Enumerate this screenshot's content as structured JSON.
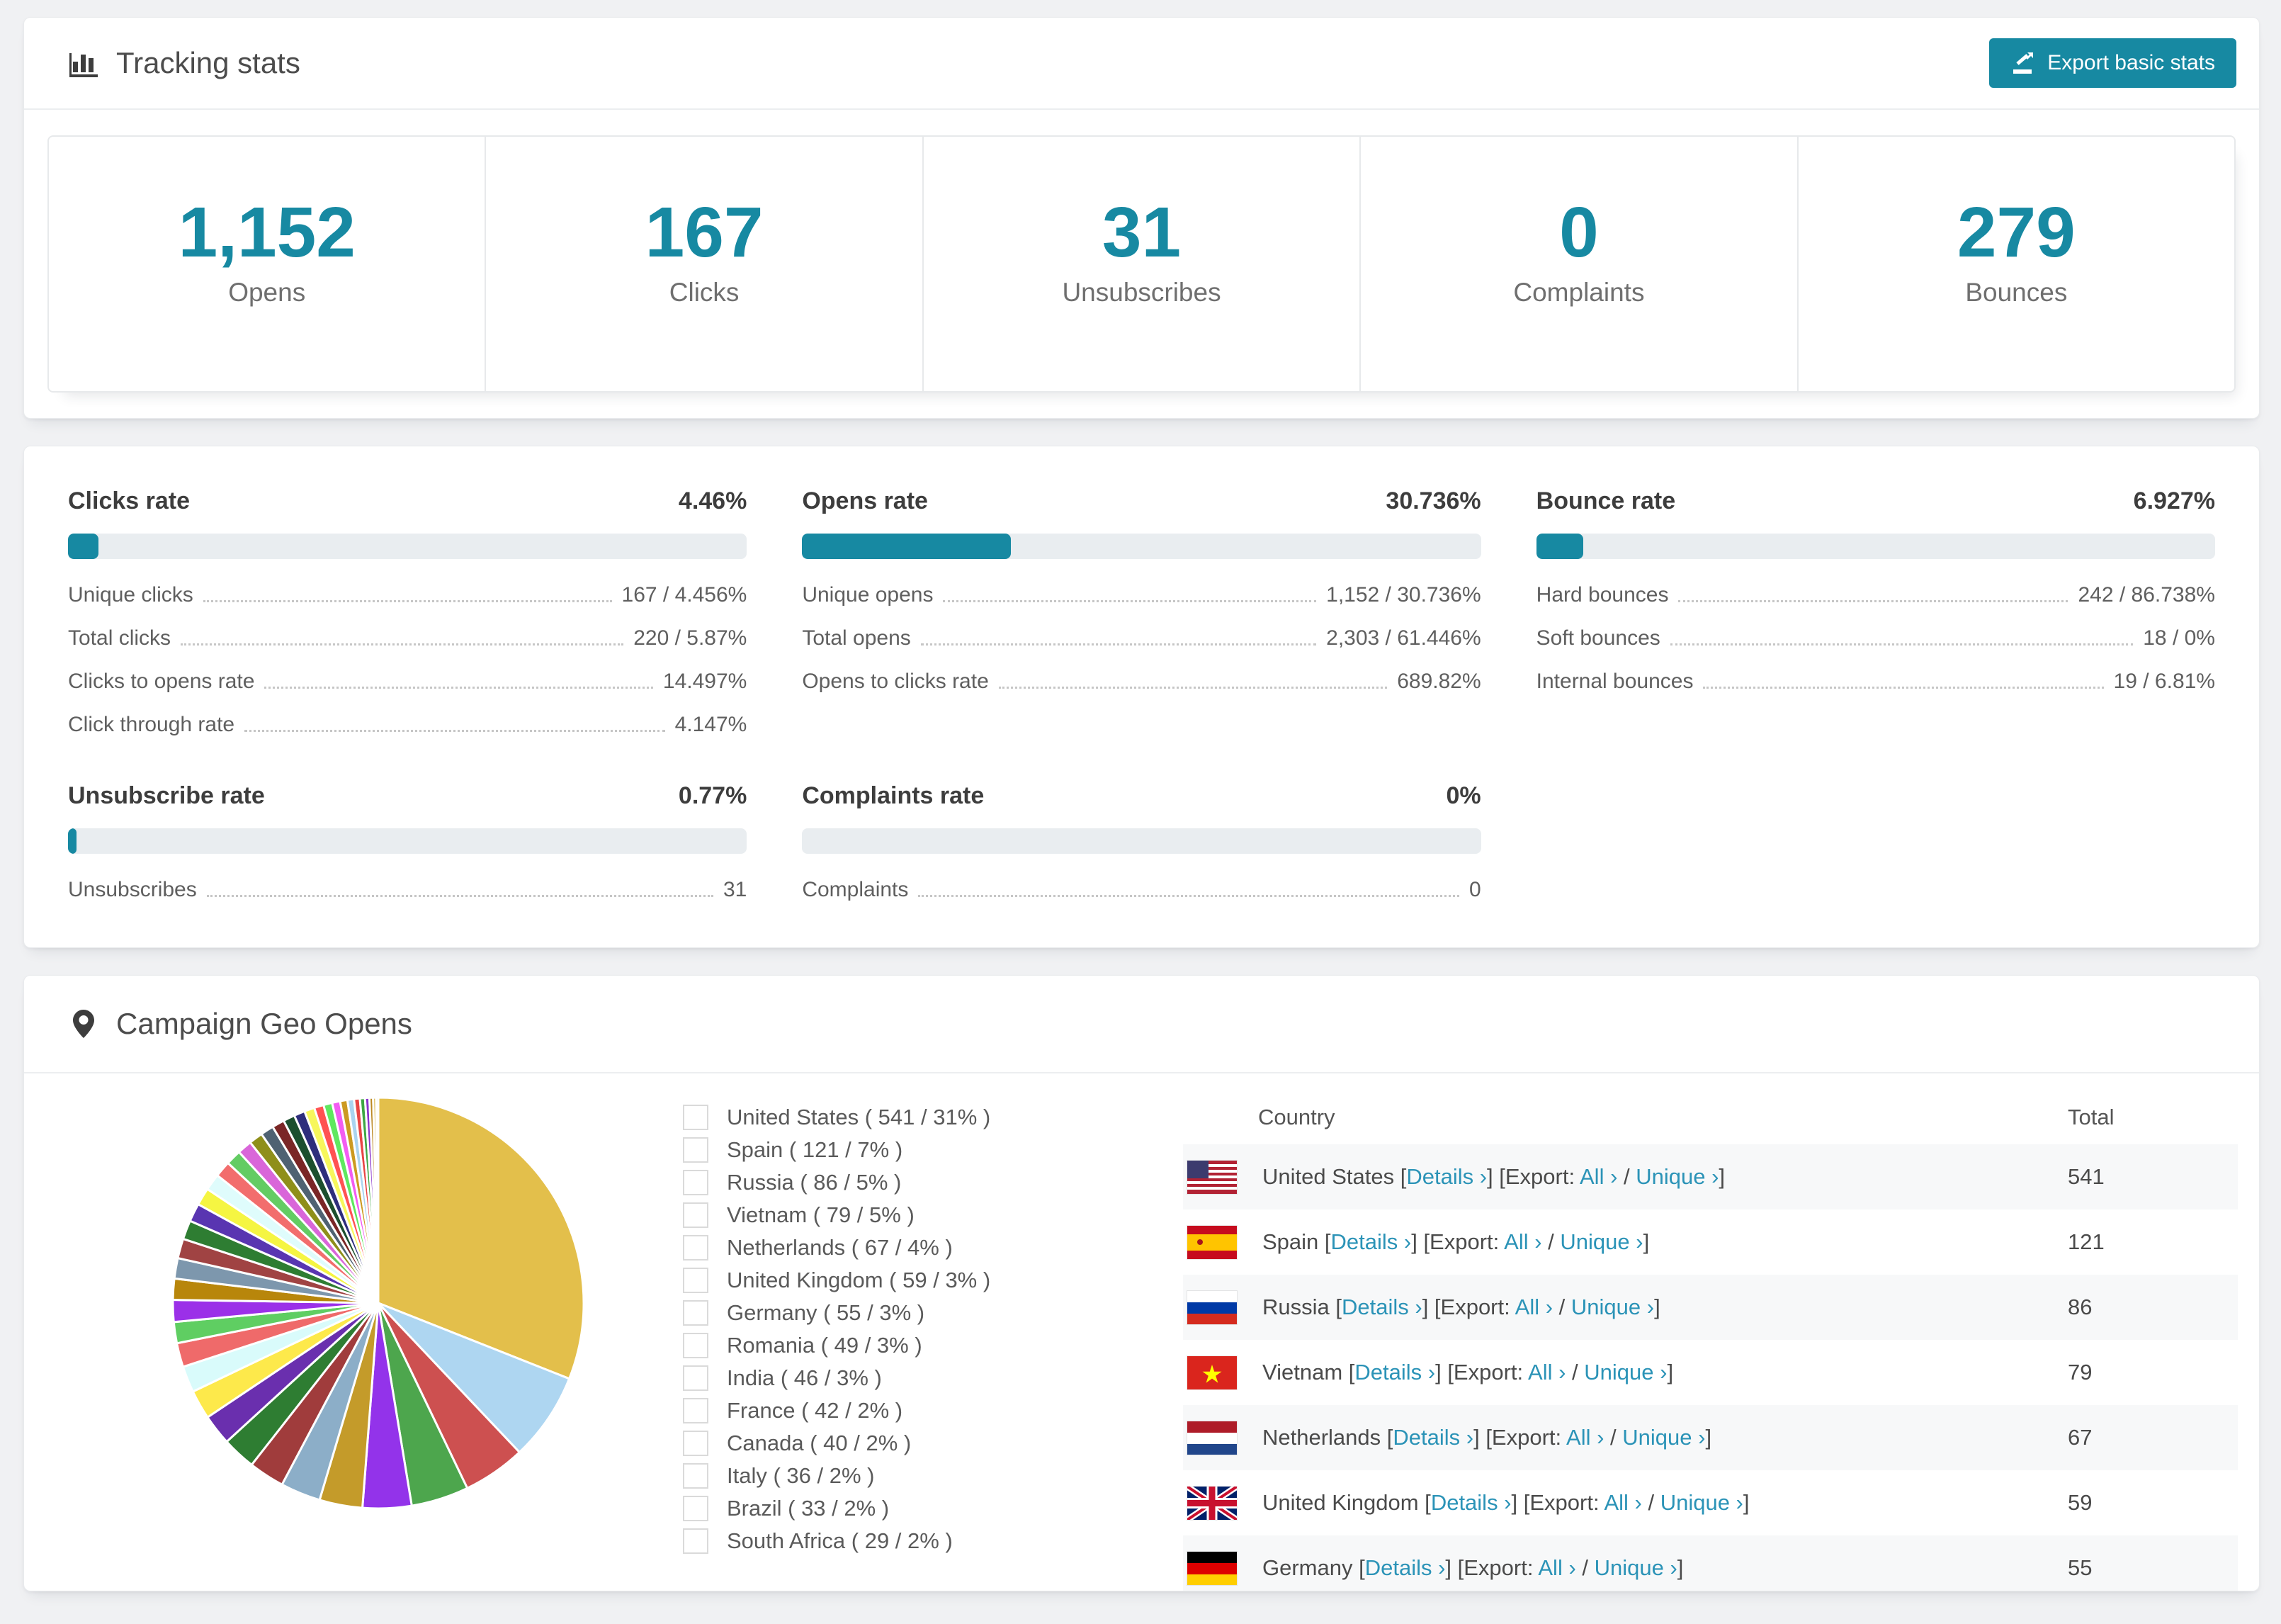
{
  "colors": {
    "teal": "#1789a2",
    "link": "#2b93b7",
    "track": "#e9edf0"
  },
  "header": {
    "title": "Tracking stats",
    "export_label": "Export basic stats"
  },
  "summary": [
    {
      "value": "1,152",
      "label": "Opens"
    },
    {
      "value": "167",
      "label": "Clicks"
    },
    {
      "value": "31",
      "label": "Unsubscribes"
    },
    {
      "value": "0",
      "label": "Complaints"
    },
    {
      "value": "279",
      "label": "Bounces"
    }
  ],
  "rate_panels": [
    {
      "title": "Clicks rate",
      "value": "4.46%",
      "pct": 4.46,
      "rows": [
        [
          "Unique clicks",
          "167 / 4.456%"
        ],
        [
          "Total clicks",
          "220 / 5.87%"
        ],
        [
          "Clicks to opens rate",
          "14.497%"
        ],
        [
          "Click through rate",
          "4.147%"
        ]
      ]
    },
    {
      "title": "Opens rate",
      "value": "30.736%",
      "pct": 30.736,
      "rows": [
        [
          "Unique opens",
          "1,152 / 30.736%"
        ],
        [
          "Total opens",
          "2,303 / 61.446%"
        ],
        [
          "Opens to clicks rate",
          "689.82%"
        ]
      ]
    },
    {
      "title": "Bounce rate",
      "value": "6.927%",
      "pct": 6.927,
      "rows": [
        [
          "Hard bounces",
          "242 / 86.738%"
        ],
        [
          "Soft bounces",
          "18 / 0%"
        ],
        [
          "Internal bounces",
          "19 / 6.81%"
        ]
      ]
    },
    {
      "title": "Unsubscribe rate",
      "value": "0.77%",
      "pct": 0.77,
      "rows": [
        [
          "Unsubscribes",
          "31"
        ]
      ]
    },
    {
      "title": "Complaints rate",
      "value": "0%",
      "pct": 0,
      "rows": [
        [
          "Complaints",
          "0"
        ]
      ]
    }
  ],
  "geo": {
    "title": "Campaign Geo Opens",
    "table": {
      "columns": [
        "Country",
        "Total"
      ],
      "links": {
        "lb": "[",
        "rb": "]",
        "details": "Details ›",
        "export_prefix": "[Export: ",
        "all": "All ›",
        "slash": " / ",
        "unique": "Unique ›"
      },
      "rows": [
        {
          "country": "United States",
          "flag": "us",
          "total": "541"
        },
        {
          "country": "Spain",
          "flag": "es",
          "total": "121"
        },
        {
          "country": "Russia",
          "flag": "ru",
          "total": "86"
        },
        {
          "country": "Vietnam",
          "flag": "vn",
          "total": "79"
        },
        {
          "country": "Netherlands",
          "flag": "nl",
          "total": "67"
        },
        {
          "country": "United Kingdom",
          "flag": "gb",
          "total": "59"
        },
        {
          "country": "Germany",
          "flag": "de",
          "total": "55"
        }
      ]
    }
  },
  "chart_data": {
    "type": "pie",
    "title": "Campaign Geo Opens",
    "legend_position": "right",
    "slices": [
      {
        "label": "United States",
        "value": 541,
        "pct": "31%",
        "color": "#e3bf4b",
        "legend": "United States ( 541 / 31% )"
      },
      {
        "label": "Spain",
        "value": 121,
        "pct": "7%",
        "color": "#aed6f1",
        "legend": "Spain ( 121 / 7% )"
      },
      {
        "label": "Russia",
        "value": 86,
        "pct": "5%",
        "color": "#cd5050",
        "legend": "Russia ( 86 / 5% )"
      },
      {
        "label": "Vietnam",
        "value": 79,
        "pct": "5%",
        "color": "#4da64d",
        "legend": "Vietnam ( 79 / 5% )"
      },
      {
        "label": "Netherlands",
        "value": 67,
        "pct": "4%",
        "color": "#9333ea",
        "legend": "Netherlands ( 67 / 4% )"
      },
      {
        "label": "United Kingdom",
        "value": 59,
        "pct": "3%",
        "color": "#c49b2a",
        "legend": "United Kingdom ( 59 / 3% )"
      },
      {
        "label": "Germany",
        "value": 55,
        "pct": "3%",
        "color": "#8caec8",
        "legend": "Germany ( 55 / 3% )"
      },
      {
        "label": "Romania",
        "value": 49,
        "pct": "3%",
        "color": "#a03c3c",
        "legend": "Romania ( 49 / 3% )"
      },
      {
        "label": "India",
        "value": 46,
        "pct": "3%",
        "color": "#2e7d32",
        "legend": "India ( 46 / 3% )"
      },
      {
        "label": "France",
        "value": 42,
        "pct": "2%",
        "color": "#6a2fae",
        "legend": "France ( 42 / 2% )"
      },
      {
        "label": "Canada",
        "value": 40,
        "pct": "2%",
        "color": "#fde94b",
        "legend": "Canada ( 40 / 2% )"
      },
      {
        "label": "Italy",
        "value": 36,
        "pct": "2%",
        "color": "#d9fbfb",
        "legend": "Italy ( 36 / 2% )"
      },
      {
        "label": "Brazil",
        "value": 33,
        "pct": "2%",
        "color": "#ef6a6a",
        "legend": "Brazil ( 33 / 2% )"
      },
      {
        "label": "South Africa",
        "value": 29,
        "pct": "2%",
        "color": "#5fce62",
        "legend": "South Africa ( 29 / 2% )"
      }
    ],
    "other_slices": [
      {
        "value": 30,
        "color": "#9b30e8"
      },
      {
        "value": 29,
        "color": "#b8860b"
      },
      {
        "value": 28,
        "color": "#7d97ad"
      },
      {
        "value": 27,
        "color": "#a04343"
      },
      {
        "value": 26,
        "color": "#2e7d32"
      },
      {
        "value": 25,
        "color": "#5935b1"
      },
      {
        "value": 24,
        "color": "#f5f542"
      },
      {
        "value": 23,
        "color": "#dffcfc"
      },
      {
        "value": 22,
        "color": "#f26d6d"
      },
      {
        "value": 21,
        "color": "#63cc63"
      },
      {
        "value": 20,
        "color": "#d966d9"
      },
      {
        "value": 19,
        "color": "#8f8f1a"
      },
      {
        "value": 18,
        "color": "#4f6272"
      },
      {
        "value": 17,
        "color": "#7a2626"
      },
      {
        "value": 16,
        "color": "#1c4f2e"
      },
      {
        "value": 15,
        "color": "#2e2e7c"
      },
      {
        "value": 14,
        "color": "#f7f75c"
      },
      {
        "value": 13,
        "color": "#ff5252"
      },
      {
        "value": 12,
        "color": "#5fe85f"
      },
      {
        "value": 11,
        "color": "#f25cf2"
      },
      {
        "value": 10,
        "color": "#cc9a22"
      },
      {
        "value": 9,
        "color": "#aad4f0"
      },
      {
        "value": 8,
        "color": "#e84444"
      },
      {
        "value": 7,
        "color": "#3da643"
      },
      {
        "value": 6,
        "color": "#8a33cc"
      },
      {
        "value": 5,
        "color": "#bb8822"
      },
      {
        "value": 4,
        "color": "#d4b03c"
      },
      {
        "value": 3,
        "color": "#88c9e8"
      }
    ]
  }
}
